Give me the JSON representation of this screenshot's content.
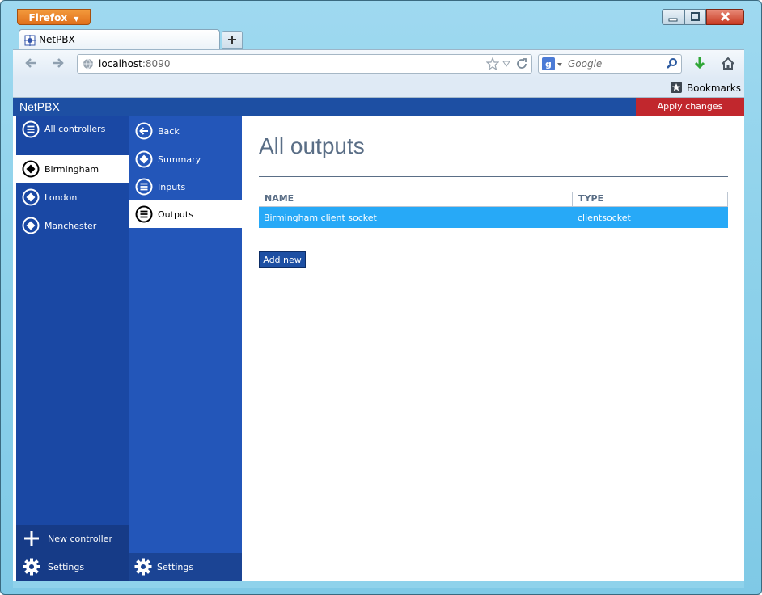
{
  "browser": {
    "menu_button": "Firefox",
    "tab_title": "NetPBX",
    "url_host": "localhost",
    "url_port": ":8090",
    "search_placeholder": "Google",
    "bookmarks_label": "Bookmarks"
  },
  "app": {
    "name": "NetPBX",
    "apply_label": "Apply changes",
    "controllers_header": "All controllers",
    "controllers": [
      {
        "label": "Birmingham"
      },
      {
        "label": "London"
      },
      {
        "label": "Manchester"
      }
    ],
    "new_controller_label": "New controller",
    "settings_label": "Settings",
    "subnav": {
      "back_label": "Back",
      "summary_label": "Summary",
      "inputs_label": "Inputs",
      "outputs_label": "Outputs",
      "settings_label": "Settings"
    },
    "main": {
      "title": "All outputs",
      "columns": [
        "NAME",
        "TYPE"
      ],
      "rows": [
        {
          "name": "Birmingham client socket",
          "type": "clientsocket"
        }
      ],
      "add_new_label": "Add new"
    }
  },
  "colors": {
    "accent": "#1d4fa3",
    "apply": "#c1272d",
    "selected_row": "#27a9f7"
  }
}
